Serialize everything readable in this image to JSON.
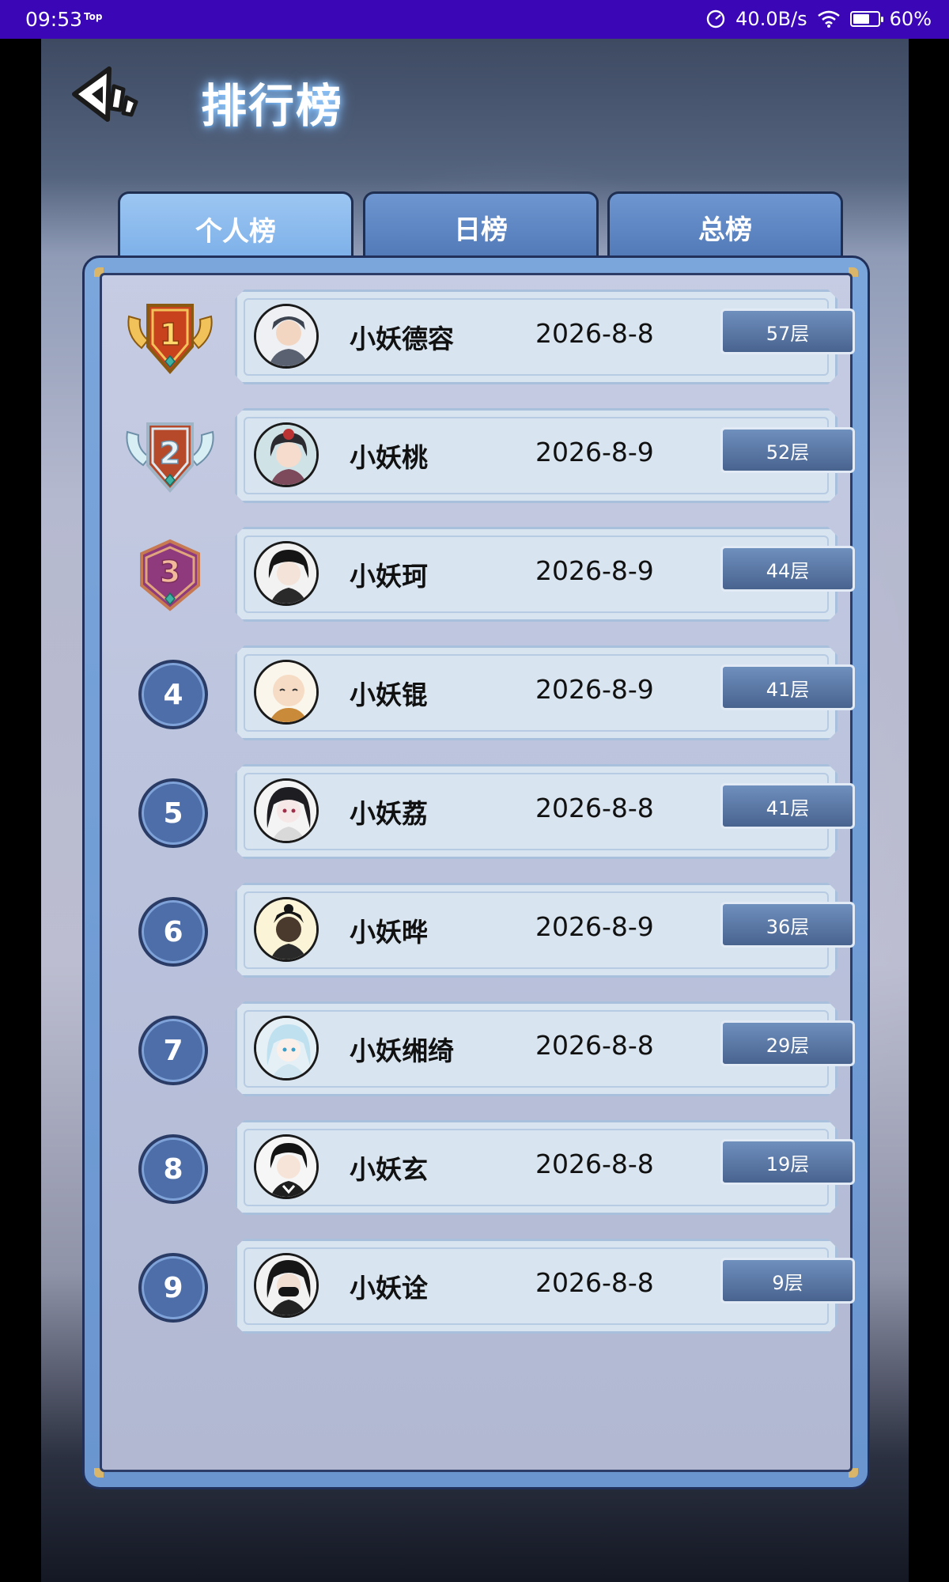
{
  "status_bar": {
    "time": "09:53",
    "top_badge": "Top",
    "net_speed": "40.0B/s",
    "battery": "60%"
  },
  "header": {
    "title": "排行榜"
  },
  "tabs": [
    {
      "label": "个人榜",
      "active": true
    },
    {
      "label": "日榜",
      "active": false
    },
    {
      "label": "总榜",
      "active": false
    }
  ],
  "leaderboard": [
    {
      "rank": "1",
      "name": "小妖德容",
      "date": "2026-8-8",
      "floor": "57层",
      "badge": "gold"
    },
    {
      "rank": "2",
      "name": "小妖桃",
      "date": "2026-8-9",
      "floor": "52层",
      "badge": "silver"
    },
    {
      "rank": "3",
      "name": "小妖珂",
      "date": "2026-8-9",
      "floor": "44层",
      "badge": "bronze"
    },
    {
      "rank": "4",
      "name": "小妖锟",
      "date": "2026-8-9",
      "floor": "41层",
      "badge": "circle"
    },
    {
      "rank": "5",
      "name": "小妖荔",
      "date": "2026-8-8",
      "floor": "41层",
      "badge": "circle"
    },
    {
      "rank": "6",
      "name": "小妖晔",
      "date": "2026-8-9",
      "floor": "36层",
      "badge": "circle"
    },
    {
      "rank": "7",
      "name": "小妖缃绮",
      "date": "2026-8-8",
      "floor": "29层",
      "badge": "circle"
    },
    {
      "rank": "8",
      "name": "小妖玄",
      "date": "2026-8-8",
      "floor": "19层",
      "badge": "circle"
    },
    {
      "rank": "9",
      "name": "小妖诠",
      "date": "2026-8-8",
      "floor": "9层",
      "badge": "circle"
    }
  ],
  "colors": {
    "status_bar": "#3a06b6",
    "tab_active": "#8bbaee",
    "tab_inactive": "#5a82bf",
    "rank_circle": "#4d6ea8",
    "floor_badge": "#5a76a3"
  }
}
